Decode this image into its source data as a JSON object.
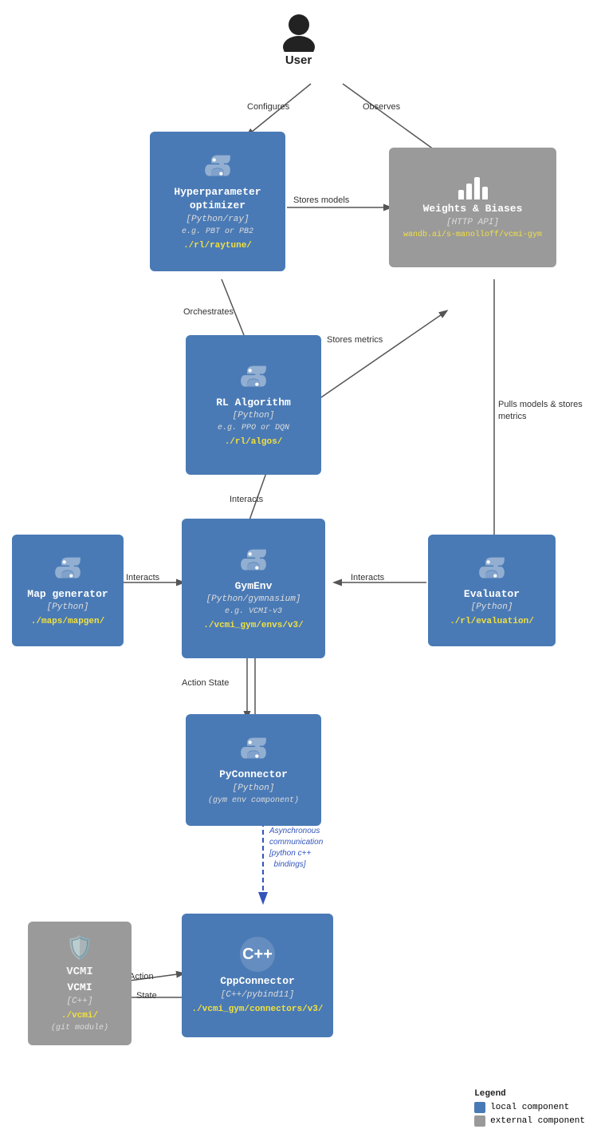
{
  "user": {
    "label": "User"
  },
  "nodes": {
    "hyperparameter": {
      "title": "Hyperparameter\noptimizer",
      "subtitle": "[Python/ray]",
      "eg": "e.g. PBT or PB2",
      "path": "./rl/raytune/"
    },
    "wandb": {
      "title": "Weights & Biases",
      "subtitle": "[HTTP API]",
      "url": "wandb.ai/s-manolloff/vcmi-gym"
    },
    "rl_algo": {
      "title": "RL Algorithm",
      "subtitle": "[Python]",
      "eg": "e.g. PPO or DQN",
      "path": "./rl/algos/"
    },
    "gymenv": {
      "title": "GymEnv",
      "subtitle": "[Python/gymnasium]",
      "eg": "e.g. VCMI-v3",
      "path": "./vcmi_gym/envs/v3/"
    },
    "map_gen": {
      "title": "Map generator",
      "subtitle": "[Python]",
      "path": "./maps/mapgen/"
    },
    "evaluator": {
      "title": "Evaluator",
      "subtitle": "[Python]",
      "path": "./rl/evaluation/"
    },
    "pyconnector": {
      "title": "PyConnector",
      "subtitle": "[Python]",
      "eg": "(gym env component)"
    },
    "vcmi": {
      "title": "VCMI",
      "subtitle": "[C++]",
      "path": "./vcmi/",
      "note": "(git module)"
    },
    "cppconnector": {
      "title": "CppConnector",
      "subtitle": "[C++/pybind11]",
      "path": "./vcmi_gym/connectors/v3/"
    }
  },
  "arrows": {
    "configures": "Configures",
    "observes": "Observes",
    "stores_models": "Stores models",
    "orchestrates": "Orchestrates",
    "stores_metrics": "Stores metrics",
    "pulls_models": "Pulls models &\nstores metrics",
    "interacts_top": "Interacts",
    "interacts_left": "Interacts",
    "interacts_right": "Interacts",
    "action_state": "Action State",
    "async_comm": "Asynchronous\ncommunication\n[python c++\n  bindings]",
    "action": "Action",
    "state": "State"
  },
  "legend": {
    "title": "Legend",
    "local": "local component",
    "external": "external component"
  },
  "colors": {
    "blue": "#4a7ab5",
    "gray": "#9a9a9a",
    "yellow": "#f0e040"
  }
}
